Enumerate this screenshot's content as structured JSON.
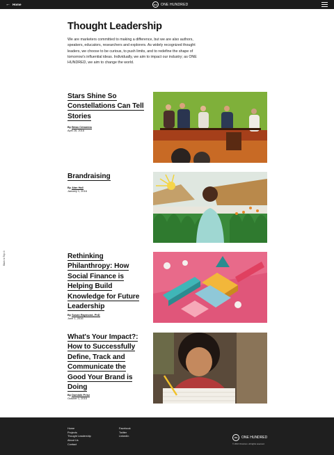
{
  "header": {
    "home_label": "Home",
    "brand_mark": "OH",
    "brand_name": "ONE HUNDRED"
  },
  "sidebar": {
    "back_to_top": "Back to Top"
  },
  "page": {
    "title": "Thought Leadership",
    "intro": "We are marketers committed to making a difference, but we are also authors, speakers, educators, researchers and explorers. As widely recognized thought leaders, we choose to be curious, to push limits, and to redefine the shape of tomorrow's influential ideas. Individually, we aim to impact our industry; as ONE HUNDRED, we aim to change the world."
  },
  "articles": [
    {
      "title": "Stars Shine So Constellations Can Tell Stories",
      "by": "By",
      "author": "Brian Crimmins",
      "date": "April 28, 2016",
      "image": "panel-discussion-photo"
    },
    {
      "title": "Brandraising",
      "by": "By",
      "author": "Alan Hall",
      "date": "January 1, 2016",
      "image": "child-illustration-photo"
    },
    {
      "title": "Rethinking Philanthropy: How Social Finance is Helping Build Knowledge for Future Leadership",
      "by": "By",
      "author": "Susan Raymond, PhD",
      "date": "June 1, 2016",
      "image": "geometric-blocks-photo"
    },
    {
      "title": "What's Your Impact?: How to Successfully Define, Track and Communicate the Good Your Brand is Doing",
      "by": "By",
      "author": "Dominik Prinz",
      "date": "October 1, 2015",
      "image": "girl-writing-photo"
    }
  ],
  "footer": {
    "nav": [
      "Home",
      "Projects",
      "Thought Leadership",
      "About Us",
      "Contact"
    ],
    "social": [
      "Facebook",
      "Twitter",
      "LinkedIn"
    ],
    "brand_mark": "OH",
    "brand_name": "ONE HUNDRED",
    "copyright": "© 2016 Omnicom. All rights reserved."
  },
  "colors": {
    "topbar": "#1b1b1b",
    "footer": "#1f1f1f",
    "text": "#111111"
  }
}
